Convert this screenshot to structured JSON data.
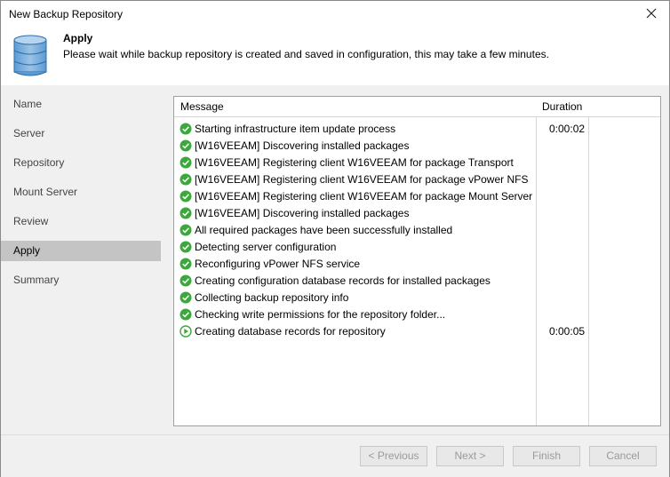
{
  "window": {
    "title": "New Backup Repository"
  },
  "header": {
    "title": "Apply",
    "description": "Please wait while backup repository is created and saved in configuration, this may take a few minutes."
  },
  "sidebar": {
    "items": [
      {
        "label": "Name",
        "active": false
      },
      {
        "label": "Server",
        "active": false
      },
      {
        "label": "Repository",
        "active": false
      },
      {
        "label": "Mount Server",
        "active": false
      },
      {
        "label": "Review",
        "active": false
      },
      {
        "label": "Apply",
        "active": true
      },
      {
        "label": "Summary",
        "active": false
      }
    ]
  },
  "log": {
    "columns": {
      "message": "Message",
      "duration": "Duration"
    },
    "rows": [
      {
        "status": "success",
        "message": "Starting infrastructure item update process",
        "duration": "0:00:02"
      },
      {
        "status": "success",
        "message": "[W16VEEAM] Discovering installed packages",
        "duration": ""
      },
      {
        "status": "success",
        "message": "[W16VEEAM] Registering client W16VEEAM for package Transport",
        "duration": ""
      },
      {
        "status": "success",
        "message": "[W16VEEAM] Registering client W16VEEAM for package vPower NFS",
        "duration": ""
      },
      {
        "status": "success",
        "message": "[W16VEEAM] Registering client W16VEEAM for package Mount Server",
        "duration": ""
      },
      {
        "status": "success",
        "message": "[W16VEEAM] Discovering installed packages",
        "duration": ""
      },
      {
        "status": "success",
        "message": "All required packages have been successfully installed",
        "duration": ""
      },
      {
        "status": "success",
        "message": "Detecting server configuration",
        "duration": ""
      },
      {
        "status": "success",
        "message": "Reconfiguring vPower NFS service",
        "duration": ""
      },
      {
        "status": "success",
        "message": "Creating configuration database records for installed packages",
        "duration": ""
      },
      {
        "status": "success",
        "message": "Collecting backup repository info",
        "duration": ""
      },
      {
        "status": "success",
        "message": "Checking write permissions for the repository folder...",
        "duration": ""
      },
      {
        "status": "running",
        "message": "Creating database records for repository",
        "duration": "0:00:05"
      }
    ]
  },
  "footer": {
    "previous_label": "< Previous",
    "next_label": "Next >",
    "finish_label": "Finish",
    "cancel_label": "Cancel"
  },
  "colors": {
    "success": "#3aa83a",
    "sidebar_bg": "#f0f0f0",
    "active_item": "#c4c4c4"
  },
  "icons": {
    "header": "database-icon",
    "close": "close-icon",
    "success": "check-circle-icon",
    "running": "play-circle-icon"
  }
}
